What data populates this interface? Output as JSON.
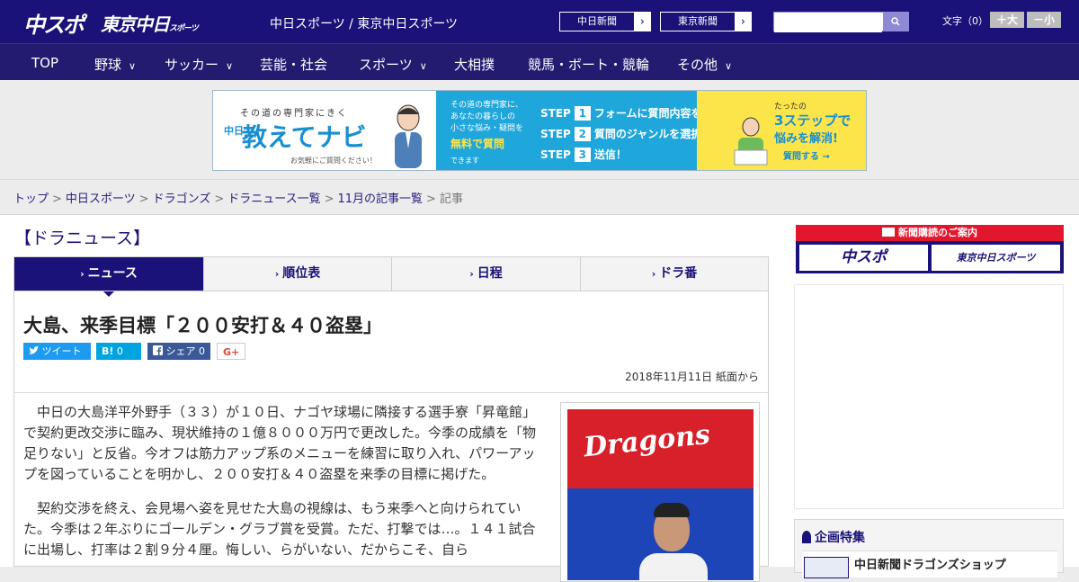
{
  "header": {
    "logo_chuspo": "中スポ",
    "logo_tokyo": "東京中日",
    "logo_tokyo_small": "スポーツ",
    "subtitle": "中日スポーツ / 東京中日スポーツ",
    "link_chunichi": "中日新聞",
    "link_tokyo": "東京新聞",
    "search_placeholder": "",
    "font_size_label": "文字（0）",
    "font_bigger": "＋大",
    "font_smaller": "－小"
  },
  "nav": [
    {
      "label": "TOP",
      "has_menu": false
    },
    {
      "label": "野球",
      "has_menu": true
    },
    {
      "label": "サッカー",
      "has_menu": true
    },
    {
      "label": "芸能・社会",
      "has_menu": false
    },
    {
      "label": "スポーツ",
      "has_menu": true
    },
    {
      "label": "大相撲",
      "has_menu": false
    },
    {
      "label": "競馬・ボート・競輪",
      "has_menu": false
    },
    {
      "label": "その他",
      "has_menu": true
    }
  ],
  "ad": {
    "tagline": "その道の専門家にきく",
    "side_small": "中日",
    "title": "教えてナビ",
    "ask": "お気軽にご質問ください！",
    "mid_line1": "その道の専門家に、",
    "mid_line2": "あなたの暮らしの",
    "mid_line3": "小さな悩み・疑問を",
    "mid_highlight": "無料で質問",
    "mid_tail": "できます",
    "steps": [
      {
        "label": "STEP",
        "num": "1",
        "text": "フォームに質問内容を入力"
      },
      {
        "label": "STEP",
        "num": "2",
        "text": "質問のジャンルを選択"
      },
      {
        "label": "STEP",
        "num": "3",
        "text": "送信！"
      }
    ],
    "right_line1": "たったの",
    "right_line2": "3ステップで",
    "right_line3": "悩みを解消!",
    "right_cta": "質問する →"
  },
  "breadcrumb": {
    "items": [
      "トップ",
      "中日スポーツ",
      "ドラゴンズ",
      "ドラニュース一覧",
      "11月の記事一覧"
    ],
    "sep": ">",
    "current": "記事"
  },
  "section_title": "【ドラニュース】",
  "tabs": [
    {
      "label": "ニュース",
      "active": true
    },
    {
      "label": "順位表",
      "active": false
    },
    {
      "label": "日程",
      "active": false
    },
    {
      "label": "ドラ番",
      "active": false
    }
  ],
  "article": {
    "title": "大島、来季目標「２００安打＆４０盗塁」",
    "share": {
      "tweet": "ツイート",
      "hatena_count": "0",
      "facebook": "シェア 0",
      "gplus": "G+"
    },
    "date": "2018年11月11日 紙面から",
    "paragraphs": [
      "中日の大島洋平外野手（３３）が１０日、ナゴヤ球場に隣接する選手寮「昇竜館」で契約更改交渉に臨み、現状維持の１億８０００万円で更改した。今季の成績を「物足りない」と反省。今オフは筋力アップ系のメニューを練習に取り入れ、パワーアップを図っていることを明かし、２００安打＆４０盗塁を来季の目標に掲げた。",
      "契約交渉を終え、会見場へ姿を見せた大島の視線は、もう来季へと向けられていた。今季は２年ぶりにゴールデン・グラブ賞を受賞。ただ、打撃では…。１４１試合に出場し、打率は２割９分４厘。悔しい、らがいない、だからこそ、自ら"
    ],
    "photo_logo": "Dragons"
  },
  "sidebar": {
    "subscribe_head": "新聞購読のご案内",
    "subscribe_chuspo": "中スポ",
    "subscribe_tokyo": "東京中日スポーツ",
    "feature_title": "企画特集",
    "feature_item": "中日新聞ドラゴンズショップ"
  },
  "colors": {
    "brand_navy": "#1a1278",
    "nav_bg": "#221b6f",
    "accent_red": "#e2172d",
    "twitter": "#1d9bf0",
    "hatena": "#00a4de",
    "facebook": "#3b5998"
  }
}
